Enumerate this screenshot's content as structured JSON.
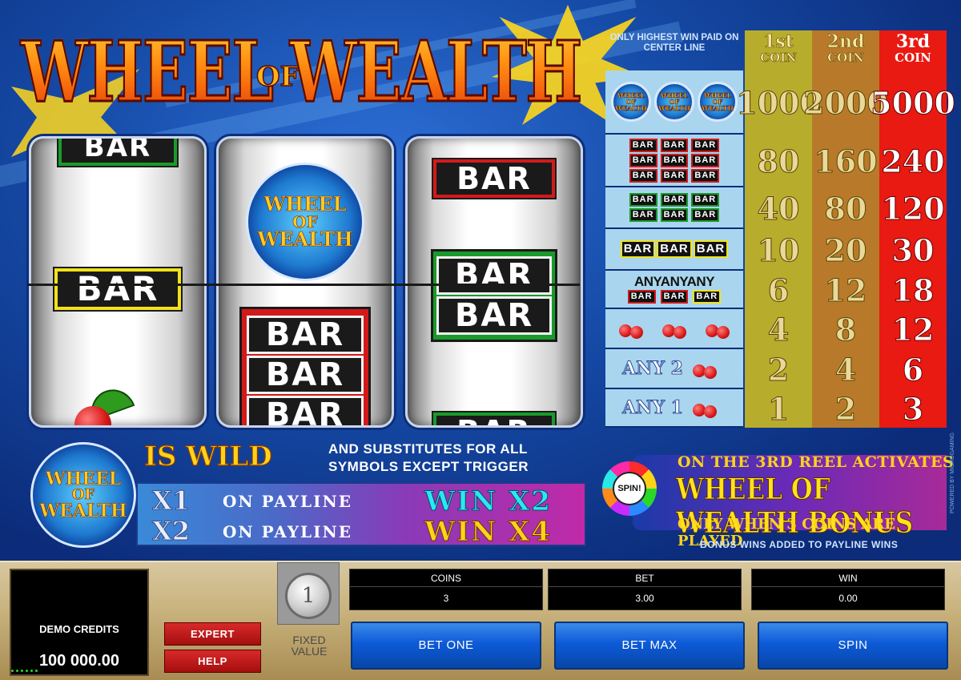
{
  "logo": {
    "word1": "WHEEL",
    "of": "OF",
    "word2": "WEALTH"
  },
  "reels": {
    "reel1": {
      "top_symbol": "BAR",
      "payline_symbol": "BAR"
    },
    "reel2": {
      "top_symbol_text": [
        "WHEEL",
        "OF",
        "WEALTH"
      ],
      "bottom_symbol": [
        "BAR",
        "BAR",
        "BAR"
      ]
    },
    "reel3": {
      "top_symbol": "BAR",
      "payline_symbol": [
        "BAR",
        "BAR"
      ],
      "bottom_partial": "BAR"
    }
  },
  "paytable": {
    "note": "ONLY HIGHEST WIN PAID ON CENTER LINE",
    "columns": [
      {
        "num": "1st",
        "word": "COIN"
      },
      {
        "num": "2nd",
        "word": "COIN"
      },
      {
        "num": "3rd",
        "word": "COIN"
      }
    ],
    "rows": [
      {
        "symbol": "wheel",
        "labels": [
          "WHEEL",
          "OF",
          "WEALTH"
        ],
        "values": [
          "1000",
          "2000",
          "5000"
        ]
      },
      {
        "symbol": "triple-bar",
        "labels": [
          "BAR",
          "BAR",
          "BAR"
        ],
        "values": [
          "80",
          "160",
          "240"
        ]
      },
      {
        "symbol": "double-bar",
        "labels": [
          "BAR",
          "BAR",
          "BAR"
        ],
        "values": [
          "40",
          "80",
          "120"
        ]
      },
      {
        "symbol": "single-bar",
        "labels": [
          "BAR",
          "BAR",
          "BAR"
        ],
        "values": [
          "10",
          "20",
          "30"
        ]
      },
      {
        "symbol": "any-bar",
        "labels": [
          "ANY",
          "ANY",
          "ANY"
        ],
        "sub": "BAR",
        "values": [
          "6",
          "12",
          "18"
        ]
      },
      {
        "symbol": "three-cherries",
        "values": [
          "4",
          "8",
          "12"
        ]
      },
      {
        "symbol": "any-2-cherries",
        "label": "ANY 2",
        "values": [
          "2",
          "4",
          "6"
        ]
      },
      {
        "symbol": "any-1-cherry",
        "label": "ANY 1",
        "values": [
          "1",
          "2",
          "3"
        ]
      }
    ]
  },
  "wild": {
    "badge": [
      "WHEEL",
      "OF",
      "WEALTH"
    ],
    "title": "IS WILD",
    "desc_line1": "AND SUBSTITUTES FOR ALL",
    "desc_line2": "SYMBOLS EXCEPT TRIGGER",
    "rows": [
      {
        "mult": "X1",
        "on": "ON PAYLINE",
        "win": "WIN X2",
        "win_color": "#2ae8f0"
      },
      {
        "mult": "X2",
        "on": "ON PAYLINE",
        "win": "WIN X4",
        "win_color": "#ffd21a"
      }
    ]
  },
  "bonus": {
    "wheel_label": "SPIN!",
    "line1": "ON THE 3RD REEL ACTIVATES",
    "line2": "WHEEL OF WEALTH BONUS",
    "line3": "ONLY WHEN 3 COINS ARE PLAYED",
    "line4": "BONUS WINS ADDED TO PAYLINE WINS",
    "powered": "POWERED BY MICROGAMING"
  },
  "panel": {
    "credits_label": "DEMO CREDITS",
    "credits_value": "100 000.00",
    "expert_label": "EXPERT",
    "help_label": "HELP",
    "coin_value": "1",
    "fixed_label_1": "FIXED",
    "fixed_label_2": "VALUE",
    "coins_label": "COINS",
    "coins_value": "3",
    "bet_label": "BET",
    "bet_value": "3.00",
    "win_label": "WIN",
    "win_value": "0.00",
    "bet_one_label": "BET ONE",
    "bet_max_label": "BET MAX",
    "spin_label": "SPIN"
  }
}
